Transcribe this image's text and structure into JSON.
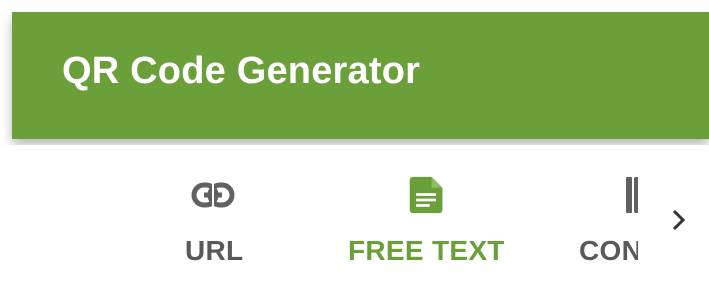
{
  "app_bar": {
    "title": "QR Code Generator",
    "color": "#6a9f3a"
  },
  "tabs": [
    {
      "label": "URL",
      "icon": "link-icon",
      "selected": false
    },
    {
      "label": "FREE TEXT",
      "icon": "document-icon",
      "selected": true
    },
    {
      "label": "CONTACT",
      "icon": "contact-icon",
      "selected": false
    }
  ],
  "scroll_next_icon": "chevron-right-icon",
  "colors": {
    "accent": "#6a9f3a",
    "tab_text": "#595959",
    "icon_inactive": "#616161"
  }
}
